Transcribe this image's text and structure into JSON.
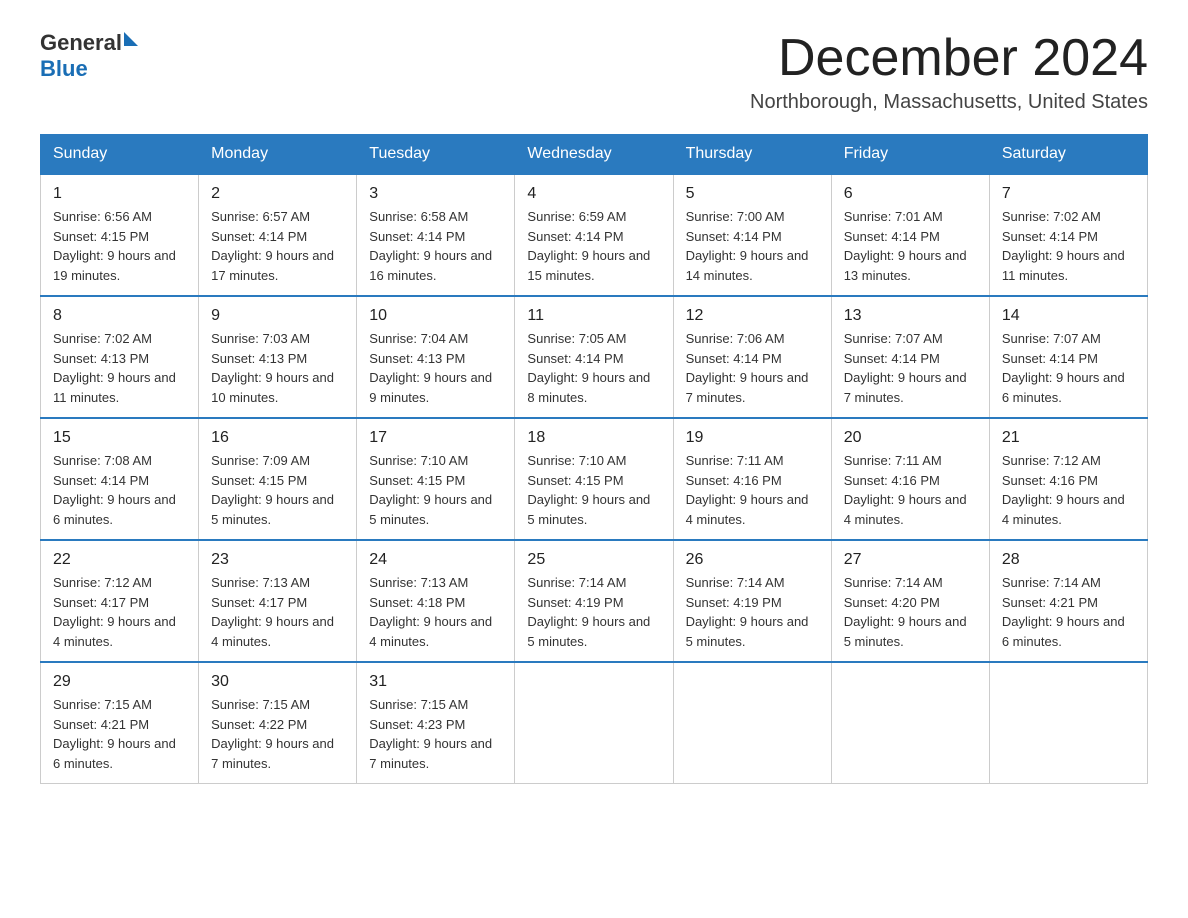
{
  "header": {
    "logo_general": "General",
    "logo_blue": "Blue",
    "month_title": "December 2024",
    "location": "Northborough, Massachusetts, United States"
  },
  "days_of_week": [
    "Sunday",
    "Monday",
    "Tuesday",
    "Wednesday",
    "Thursday",
    "Friday",
    "Saturday"
  ],
  "weeks": [
    [
      {
        "day": "1",
        "sunrise": "6:56 AM",
        "sunset": "4:15 PM",
        "daylight": "9 hours and 19 minutes."
      },
      {
        "day": "2",
        "sunrise": "6:57 AM",
        "sunset": "4:14 PM",
        "daylight": "9 hours and 17 minutes."
      },
      {
        "day": "3",
        "sunrise": "6:58 AM",
        "sunset": "4:14 PM",
        "daylight": "9 hours and 16 minutes."
      },
      {
        "day": "4",
        "sunrise": "6:59 AM",
        "sunset": "4:14 PM",
        "daylight": "9 hours and 15 minutes."
      },
      {
        "day": "5",
        "sunrise": "7:00 AM",
        "sunset": "4:14 PM",
        "daylight": "9 hours and 14 minutes."
      },
      {
        "day": "6",
        "sunrise": "7:01 AM",
        "sunset": "4:14 PM",
        "daylight": "9 hours and 13 minutes."
      },
      {
        "day": "7",
        "sunrise": "7:02 AM",
        "sunset": "4:14 PM",
        "daylight": "9 hours and 11 minutes."
      }
    ],
    [
      {
        "day": "8",
        "sunrise": "7:02 AM",
        "sunset": "4:13 PM",
        "daylight": "9 hours and 11 minutes."
      },
      {
        "day": "9",
        "sunrise": "7:03 AM",
        "sunset": "4:13 PM",
        "daylight": "9 hours and 10 minutes."
      },
      {
        "day": "10",
        "sunrise": "7:04 AM",
        "sunset": "4:13 PM",
        "daylight": "9 hours and 9 minutes."
      },
      {
        "day": "11",
        "sunrise": "7:05 AM",
        "sunset": "4:14 PM",
        "daylight": "9 hours and 8 minutes."
      },
      {
        "day": "12",
        "sunrise": "7:06 AM",
        "sunset": "4:14 PM",
        "daylight": "9 hours and 7 minutes."
      },
      {
        "day": "13",
        "sunrise": "7:07 AM",
        "sunset": "4:14 PM",
        "daylight": "9 hours and 7 minutes."
      },
      {
        "day": "14",
        "sunrise": "7:07 AM",
        "sunset": "4:14 PM",
        "daylight": "9 hours and 6 minutes."
      }
    ],
    [
      {
        "day": "15",
        "sunrise": "7:08 AM",
        "sunset": "4:14 PM",
        "daylight": "9 hours and 6 minutes."
      },
      {
        "day": "16",
        "sunrise": "7:09 AM",
        "sunset": "4:15 PM",
        "daylight": "9 hours and 5 minutes."
      },
      {
        "day": "17",
        "sunrise": "7:10 AM",
        "sunset": "4:15 PM",
        "daylight": "9 hours and 5 minutes."
      },
      {
        "day": "18",
        "sunrise": "7:10 AM",
        "sunset": "4:15 PM",
        "daylight": "9 hours and 5 minutes."
      },
      {
        "day": "19",
        "sunrise": "7:11 AM",
        "sunset": "4:16 PM",
        "daylight": "9 hours and 4 minutes."
      },
      {
        "day": "20",
        "sunrise": "7:11 AM",
        "sunset": "4:16 PM",
        "daylight": "9 hours and 4 minutes."
      },
      {
        "day": "21",
        "sunrise": "7:12 AM",
        "sunset": "4:16 PM",
        "daylight": "9 hours and 4 minutes."
      }
    ],
    [
      {
        "day": "22",
        "sunrise": "7:12 AM",
        "sunset": "4:17 PM",
        "daylight": "9 hours and 4 minutes."
      },
      {
        "day": "23",
        "sunrise": "7:13 AM",
        "sunset": "4:17 PM",
        "daylight": "9 hours and 4 minutes."
      },
      {
        "day": "24",
        "sunrise": "7:13 AM",
        "sunset": "4:18 PM",
        "daylight": "9 hours and 4 minutes."
      },
      {
        "day": "25",
        "sunrise": "7:14 AM",
        "sunset": "4:19 PM",
        "daylight": "9 hours and 5 minutes."
      },
      {
        "day": "26",
        "sunrise": "7:14 AM",
        "sunset": "4:19 PM",
        "daylight": "9 hours and 5 minutes."
      },
      {
        "day": "27",
        "sunrise": "7:14 AM",
        "sunset": "4:20 PM",
        "daylight": "9 hours and 5 minutes."
      },
      {
        "day": "28",
        "sunrise": "7:14 AM",
        "sunset": "4:21 PM",
        "daylight": "9 hours and 6 minutes."
      }
    ],
    [
      {
        "day": "29",
        "sunrise": "7:15 AM",
        "sunset": "4:21 PM",
        "daylight": "9 hours and 6 minutes."
      },
      {
        "day": "30",
        "sunrise": "7:15 AM",
        "sunset": "4:22 PM",
        "daylight": "9 hours and 7 minutes."
      },
      {
        "day": "31",
        "sunrise": "7:15 AM",
        "sunset": "4:23 PM",
        "daylight": "9 hours and 7 minutes."
      },
      null,
      null,
      null,
      null
    ]
  ]
}
